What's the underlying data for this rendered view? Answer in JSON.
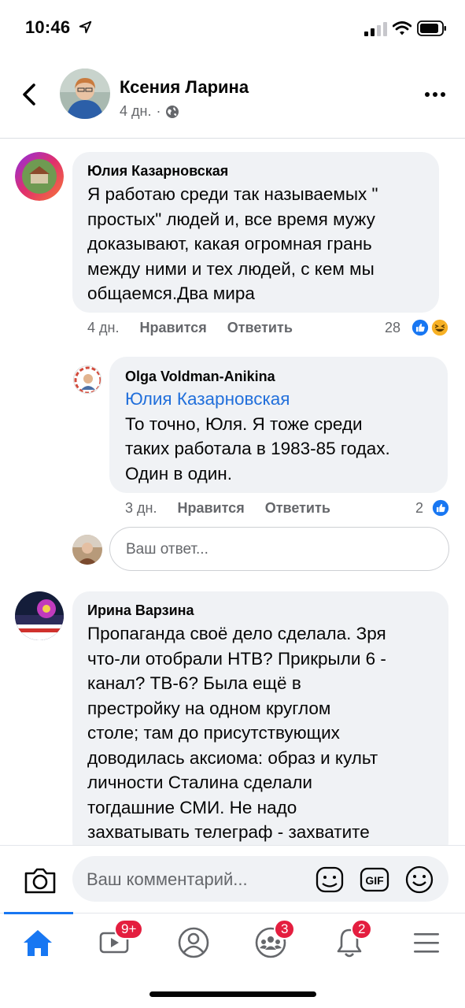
{
  "status_bar": {
    "time": "10:46"
  },
  "post": {
    "author": "Ксения Ларина",
    "time": "4 дн.",
    "separator": "·"
  },
  "comments": [
    {
      "author": "Юлия Казарновская",
      "text": [
        "Я работаю среди так называемых \"",
        "простых\" людей и, все время мужу",
        "доказывают, какая огромная грань",
        "между  ними и тех людей, с кем мы",
        "общаемся.Два мира"
      ],
      "time": "4 дн.",
      "like_label": "Нравится",
      "reply_label": "Ответить",
      "reactions": "28",
      "reaction_types": [
        "like",
        "haha"
      ]
    },
    {
      "author": "Olga Voldman-Anikina",
      "mention": "Юлия Казарновская",
      "text": [
        "То точно, Юля. Я тоже среди",
        "таких работала в 1983-85 годах.",
        "Один в один."
      ],
      "time": "3 дн.",
      "like_label": "Нравится",
      "reply_label": "Ответить",
      "reactions": "2",
      "reaction_types": [
        "like"
      ]
    },
    {
      "author": "Ирина Варзина",
      "text": [
        "Пропаганда своё дело сделала. Зря",
        "что-ли отобрали НТВ? Прикрыли 6 -",
        "канал? ТВ-6? Была ещё в",
        "престройку на одном круглом",
        "столе; там до присутствующих",
        "доводилась аксиома: образ и культ",
        "личности Сталина сделали",
        "тогдашние СМИ. Не надо",
        "захватывать телеграф - захватите"
      ]
    }
  ],
  "reply_input": {
    "placeholder": "Ваш ответ..."
  },
  "composer": {
    "placeholder": "Ваш комментарий..."
  },
  "tabbar": {
    "badges": {
      "watch": "9+",
      "groups": "3",
      "notifications": "2"
    }
  },
  "colors": {
    "accent": "#1877f2",
    "badge": "#e41e3f",
    "bubble": "#f0f2f5",
    "secondary_text": "#65676b"
  }
}
